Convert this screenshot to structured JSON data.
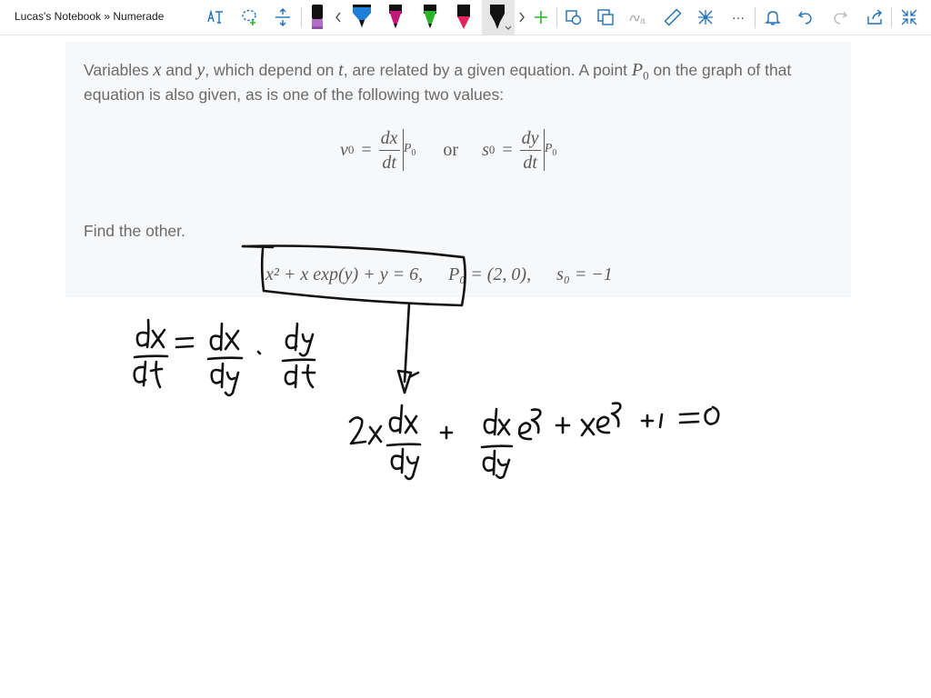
{
  "window": {
    "title": "Lucas's Notebook » Numerade"
  },
  "toolbar": {
    "icons": [
      "text-to-shape-icon",
      "lasso-select-icon",
      "insert-space-icon",
      "highlighter-pen-icon",
      "scroll-left-icon",
      "blue-pen-icon",
      "magenta-pen-icon",
      "green-pen-icon",
      "red-pen-icon",
      "black-pen-icon",
      "scroll-right-icon",
      "add-pen-icon",
      "shape-select-icon",
      "rotate-icon",
      "ink-to-text-icon",
      "ruler-icon",
      "snap-grid-icon",
      "more-icon",
      "notification-icon",
      "undo-icon",
      "redo-icon",
      "share-icon",
      "fullscreen-icon"
    ],
    "more_label": "···"
  },
  "colors": {
    "pen_blue": "#1e7fd6",
    "pen_magenta": "#c2187a",
    "pen_green": "#2bb42b",
    "pen_red": "#e0245e",
    "pen_black": "#111111",
    "highlighter": "#b06ec9",
    "toolbar_icon": "#1f6fb5",
    "card_bg": "#f7f8fa",
    "text": "#6a6a6a"
  },
  "problem": {
    "p1_a": "Variables ",
    "p1_x": "x",
    "p1_b": " and ",
    "p1_y": "y",
    "p1_c": ", which depend on ",
    "p1_t": "t",
    "p1_d": ", are related by a given equation. A point ",
    "p1_P": "P",
    "p1_Psub": "0",
    "p1_e": " on the graph of that",
    "p2": "equation is also given, as is one of the following two values:",
    "def_v0_lhs": "v",
    "def_v0_sub": "0",
    "def_equals": "=",
    "def_v0_num": "dx",
    "def_v0_den": "dt",
    "def_or": "or",
    "def_s0_lhs": "s",
    "def_s0_sub": "0",
    "def_s0_num": "dy",
    "def_s0_den": "dt",
    "def_eval_P": "P",
    "def_eval_sub": "0",
    "find": "Find the other.",
    "eq_main": "x² + x exp(y) + y = 6,",
    "eq_point": "P₀ = (2, 0),",
    "eq_s0": "s₀ = −1"
  }
}
